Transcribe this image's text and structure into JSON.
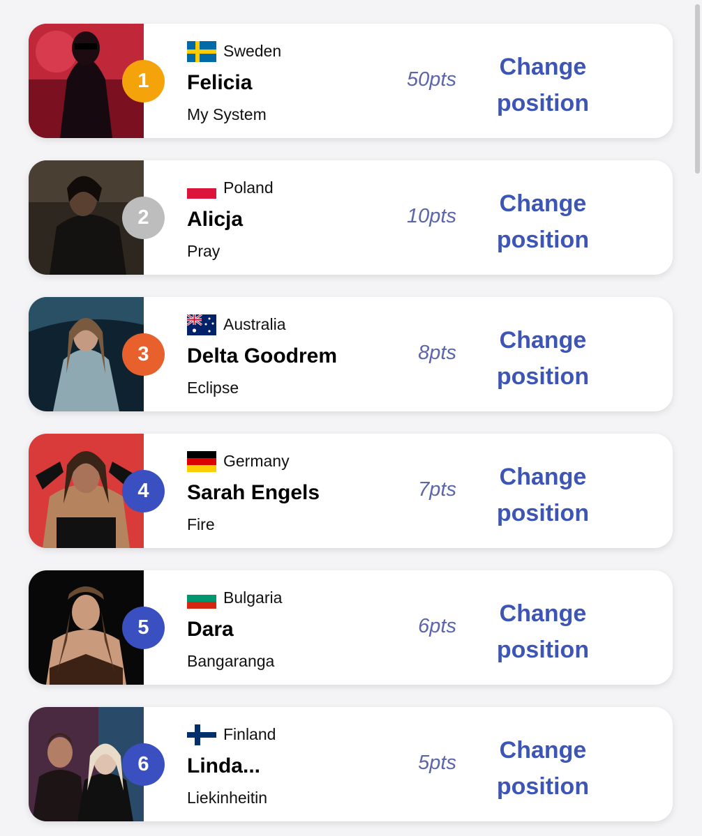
{
  "entries": [
    {
      "rank": "1",
      "country": "Sweden",
      "artist": "Felicia",
      "song": "My System",
      "points": "50pts",
      "action": "Change position",
      "badge_color": "#f5a30a"
    },
    {
      "rank": "2",
      "country": "Poland",
      "artist": "Alicja",
      "song": "Pray",
      "points": "10pts",
      "action": "Change position",
      "badge_color": "#bdbdbd"
    },
    {
      "rank": "3",
      "country": "Australia",
      "artist": "Delta Goodrem",
      "song": "Eclipse",
      "points": "8pts",
      "action": "Change position",
      "badge_color": "#e8602c"
    },
    {
      "rank": "4",
      "country": "Germany",
      "artist": "Sarah Engels",
      "song": "Fire",
      "points": "7pts",
      "action": "Change position",
      "badge_color": "#3a4fc0"
    },
    {
      "rank": "5",
      "country": "Bulgaria",
      "artist": "Dara",
      "song": "Bangaranga",
      "points": "6pts",
      "action": "Change position",
      "badge_color": "#3a4fc0"
    },
    {
      "rank": "6",
      "country": "Finland",
      "artist": "Linda...",
      "song": "Liekinheitin",
      "points": "5pts",
      "action": "Change position",
      "badge_color": "#3a4fc0"
    }
  ],
  "colors": {
    "action_text": "#3d55b5",
    "points_text": "#5b64ad",
    "page_background": "#f4f4f6"
  }
}
